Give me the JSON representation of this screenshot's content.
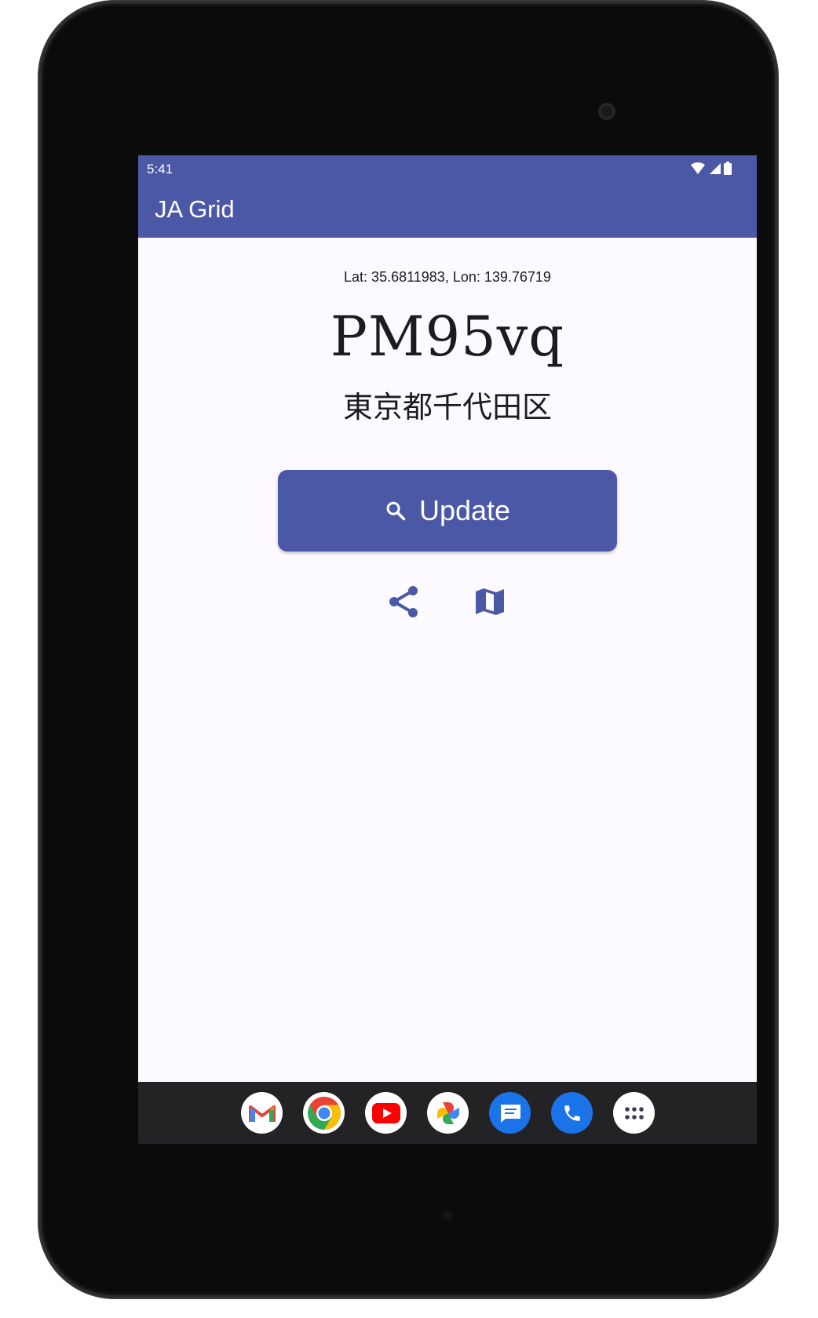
{
  "status_bar": {
    "time": "5:41"
  },
  "app_bar": {
    "title": "JA Grid"
  },
  "location": {
    "latlon_text": "Lat: 35.6811983, Lon: 139.76719",
    "grid_locator": "PM95vq",
    "address": "東京都千代田区"
  },
  "actions": {
    "update_label": "Update",
    "update_icon": "search-icon",
    "share_icon": "share-icon",
    "map_icon": "map-icon"
  },
  "dock": {
    "apps": [
      "gmail",
      "chrome",
      "youtube",
      "photos",
      "messages",
      "phone",
      "app-drawer"
    ]
  },
  "colors": {
    "primary": "#4b58a6",
    "background": "#fdfaff",
    "nav_bar": "#232326"
  }
}
